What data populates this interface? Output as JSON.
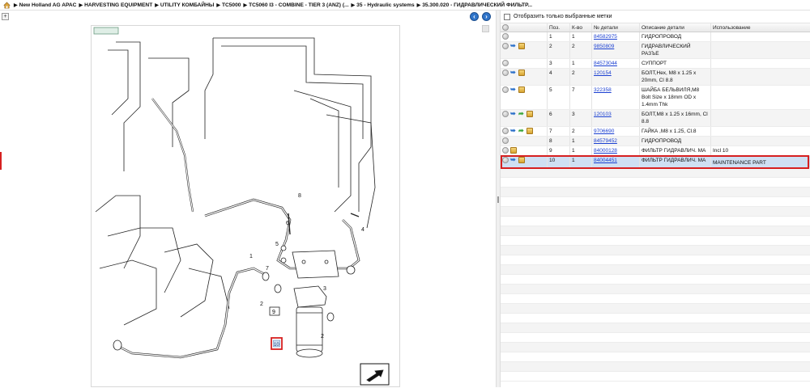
{
  "breadcrumb": [
    "New Holland AG APAC",
    "HARVESTING EQUIPMENT",
    "UTILITY КОМБАЙНЫ",
    "TC5000",
    "TC5060 I3 - COMBINE - TIER 3 (ANZ) (...",
    "35 - Hydraulic systems",
    "35.300.020 - ГИДРАВЛИЧЕСКИЙ ФИЛЬТР..."
  ],
  "toolbar": {
    "expand_label": "+",
    "prev_label": "‹",
    "next_label": "›"
  },
  "diagram": {
    "badge_label": "Info",
    "callouts": [
      "1",
      "2",
      "3",
      "4",
      "5",
      "6",
      "7",
      "8",
      "9",
      "10",
      "2",
      "5"
    ],
    "selected_callout": "10"
  },
  "filter": {
    "label": "Отобразить только выбранные метки"
  },
  "table": {
    "headers": {
      "pos": "Поз.",
      "qty": "К-во",
      "part_no": "№ детали",
      "desc": "Описание детали",
      "usage": "Использование"
    },
    "rows": [
      {
        "icons": [
          "info"
        ],
        "pos": "1",
        "qty": "1",
        "part_no": "84582975",
        "desc": "ГИДРОПРОВОД",
        "usage": ""
      },
      {
        "icons": [
          "info",
          "arrow",
          "box"
        ],
        "pos": "2",
        "qty": "2",
        "part_no": "9850809",
        "desc": "ГИДРАВЛИЧЕСКИЙ РАЗЪЕ",
        "usage": ""
      },
      {
        "icons": [
          "info"
        ],
        "pos": "3",
        "qty": "1",
        "part_no": "84573044",
        "desc": "СУППОРТ",
        "usage": ""
      },
      {
        "icons": [
          "info",
          "arrow",
          "box"
        ],
        "pos": "4",
        "qty": "2",
        "part_no": "120154",
        "desc": "БОЛТ,Hex, M8 x 1.25 x 20mm, Cl 8.8",
        "usage": ""
      },
      {
        "icons": [
          "info",
          "arrow",
          "box"
        ],
        "pos": "5",
        "qty": "7",
        "part_no": "322358",
        "desc": "ШАЙБА БЕЛЬВИЛЯ,M8 Bolt Size x 18mm OD x 1.4mm Thk",
        "usage": ""
      },
      {
        "icons": [
          "info",
          "arrow",
          "green",
          "box"
        ],
        "pos": "6",
        "qty": "3",
        "part_no": "120103",
        "desc": "БОЛТ,M8 x 1.25 x 16mm, Cl 8.8",
        "usage": ""
      },
      {
        "icons": [
          "info",
          "arrow",
          "green",
          "box"
        ],
        "pos": "7",
        "qty": "2",
        "part_no": "9706690",
        "desc": "ГАЙКА ,M8 x 1.25, Cl.8",
        "usage": ""
      },
      {
        "icons": [
          "info"
        ],
        "pos": "8",
        "qty": "1",
        "part_no": "84579452",
        "desc": "ГИДРОПРОВОД",
        "usage": ""
      },
      {
        "icons": [
          "info",
          "box"
        ],
        "pos": "9",
        "qty": "1",
        "part_no": "84000128",
        "desc": "ФИЛЬТР ГИДРАВЛИЧ. МА",
        "usage": "Incl 10"
      },
      {
        "icons": [
          "info",
          "arrow",
          "box"
        ],
        "pos": "10",
        "qty": "1",
        "part_no": "84004451",
        "desc": "ФИЛЬТР ГИДРАВЛИЧ. МА",
        "usage": "",
        "sub": "MAINTENANCE PART",
        "selected": true
      }
    ]
  },
  "colors": {
    "selection": "#d62020",
    "link": "#1a3fd1",
    "nav_button": "#2f74c9"
  }
}
